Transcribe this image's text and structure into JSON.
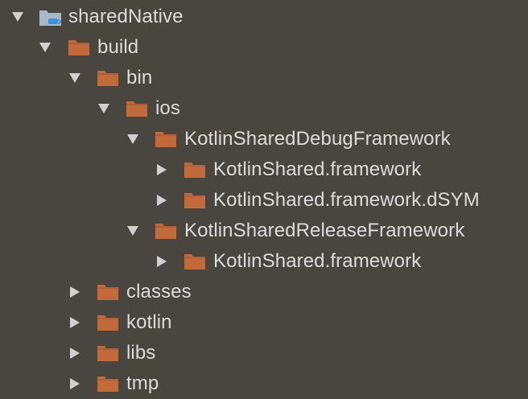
{
  "colors": {
    "background": "#48463f",
    "text": "#dcdcdc",
    "arrow": "#d0d0d0",
    "folder": "#c26a3a",
    "folder_tab": "#b35f33",
    "module_folder": "#a8b8c8",
    "module_badge": "#3f8fd6"
  },
  "tree": {
    "items": [
      {
        "label": "sharedNative",
        "expanded": true,
        "icon": "module-folder-icon"
      },
      {
        "label": "build",
        "expanded": true,
        "icon": "folder-icon"
      },
      {
        "label": "bin",
        "expanded": true,
        "icon": "folder-icon"
      },
      {
        "label": "ios",
        "expanded": true,
        "icon": "folder-icon"
      },
      {
        "label": "KotlinSharedDebugFramework",
        "expanded": true,
        "icon": "folder-icon"
      },
      {
        "label": "KotlinShared.framework",
        "expanded": false,
        "icon": "folder-icon"
      },
      {
        "label": "KotlinShared.framework.dSYM",
        "expanded": false,
        "icon": "folder-icon"
      },
      {
        "label": "KotlinSharedReleaseFramework",
        "expanded": true,
        "icon": "folder-icon"
      },
      {
        "label": "KotlinShared.framework",
        "expanded": false,
        "icon": "folder-icon"
      },
      {
        "label": "classes",
        "expanded": false,
        "icon": "folder-icon"
      },
      {
        "label": "kotlin",
        "expanded": false,
        "icon": "folder-icon"
      },
      {
        "label": "libs",
        "expanded": false,
        "icon": "folder-icon"
      },
      {
        "label": "tmp",
        "expanded": false,
        "icon": "folder-icon"
      }
    ]
  }
}
